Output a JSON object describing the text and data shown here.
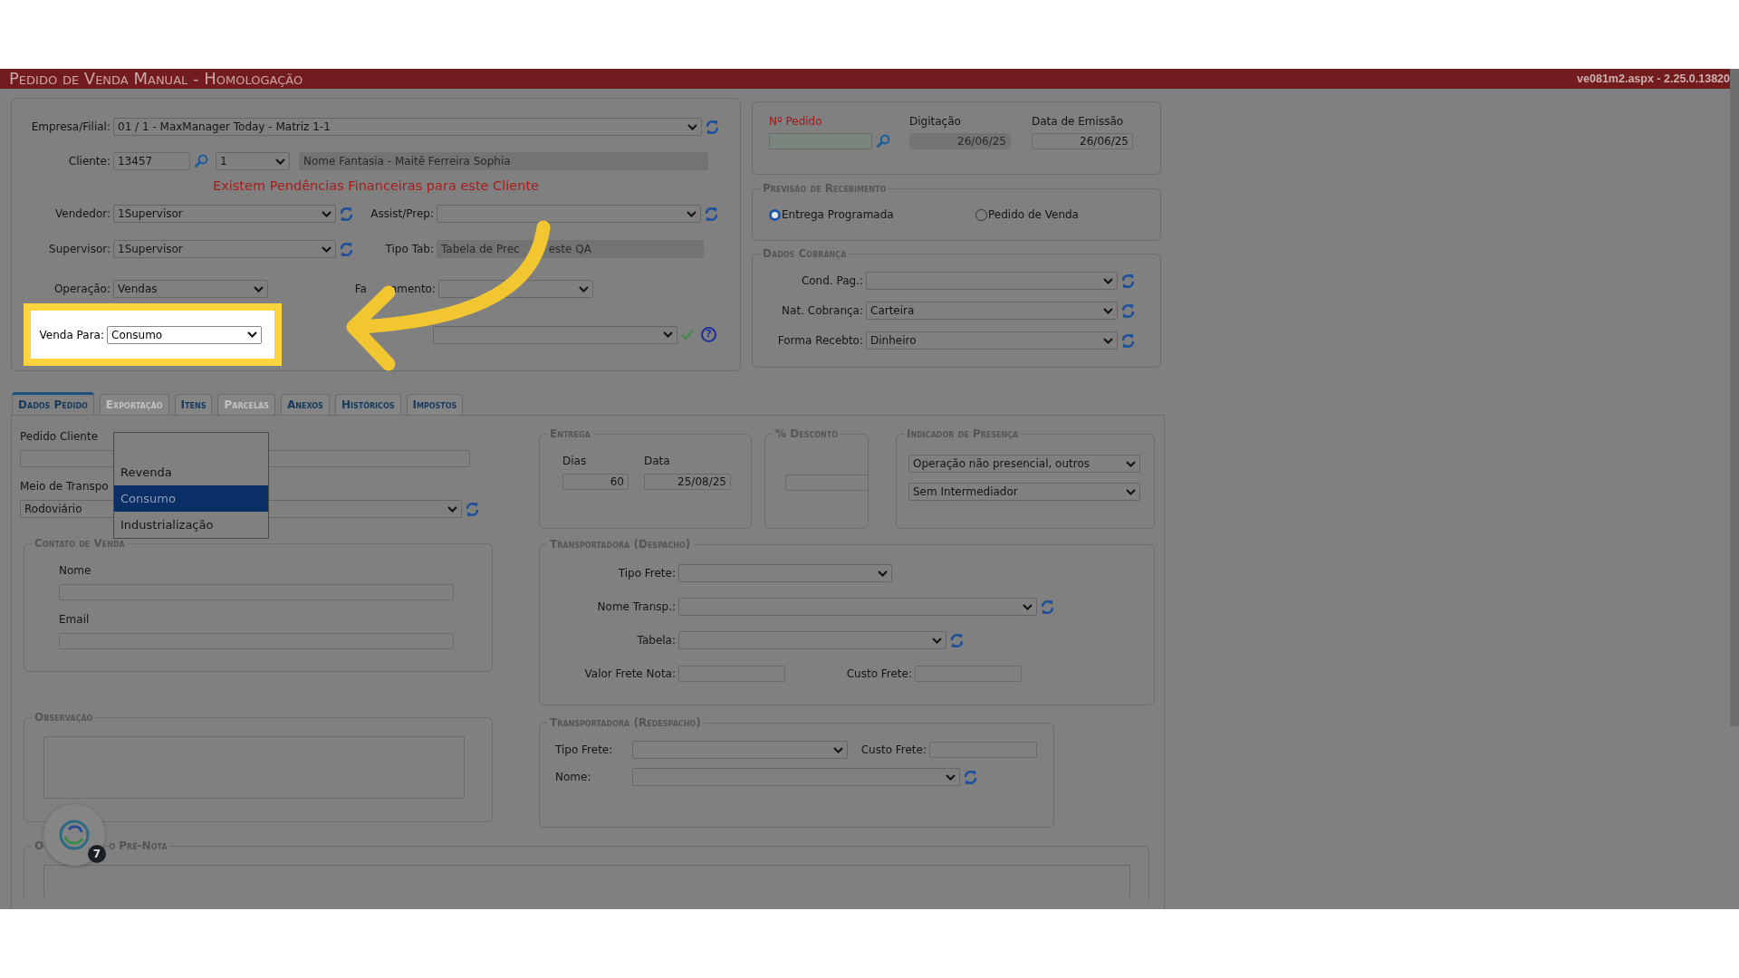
{
  "header": {
    "title": "Pedido de Venda Manual  - Homologação",
    "version": "ve081m2.aspx - 2.25.0.13820"
  },
  "form": {
    "empresa": {
      "label": "Empresa/Filial:",
      "value": "01 / 1 - MaxManager Today - Matriz 1-1"
    },
    "cliente": {
      "label": "Cliente:",
      "code": "13457",
      "seq": "1",
      "fantasia": "Nome Fantasia - Maitê Ferreira Sophia"
    },
    "alert": "Existem Pendências Financeiras para este Cliente",
    "vendedor": {
      "label": "Vendedor:",
      "value": "1Supervisor"
    },
    "assist": {
      "label": "Assist/Prep:"
    },
    "supervisor": {
      "label": "Supervisor:",
      "value": "1Supervisor"
    },
    "tipo_tab": {
      "label": "Tipo Tab:",
      "value_start": "Tabela de Prec",
      "value_end": "este QA"
    },
    "operacao": {
      "label": "Operação:",
      "value": "Vendas"
    },
    "faturamento": {
      "label_start": "Fa",
      "label_end": "amento:"
    },
    "venda_para": {
      "label": "Venda Para:",
      "value": "Consumo",
      "highlighted": true
    },
    "help": "?"
  },
  "pedido": {
    "numero_label": "Nº Pedido",
    "digitacao_label": "Digitação",
    "digitacao": "26/06/25",
    "emissao_label": "Data de Emissão",
    "emissao": "26/06/25"
  },
  "previsao": {
    "legend": "Previsão de Recebimento",
    "options": [
      {
        "label": "Entrega Programada",
        "selected": true
      },
      {
        "label": "Pedido de Venda",
        "selected": false
      }
    ]
  },
  "cobranca": {
    "legend": "Dados Cobrança",
    "fields": [
      {
        "label": "Cond. Pag.:"
      },
      {
        "label": "Nat. Cobrança:",
        "value": "Carteira"
      },
      {
        "label": "Forma Recebto:",
        "value": "Dinheiro"
      }
    ]
  },
  "tabs": [
    {
      "label": "Dados Pedido",
      "selected": true,
      "disabled": false
    },
    {
      "label": "Exportação",
      "selected": false,
      "disabled": true
    },
    {
      "label": "Itens",
      "selected": false,
      "disabled": false
    },
    {
      "label": "Parcelas",
      "selected": false,
      "disabled": true
    },
    {
      "label": "Anexos",
      "selected": false,
      "disabled": false
    },
    {
      "label": "Históricos",
      "selected": false,
      "disabled": false
    },
    {
      "label": "Impostos",
      "selected": false,
      "disabled": false
    }
  ],
  "dados": {
    "pedido_cliente_label": "Pedido Cliente",
    "meio_label": "Meio de Transpo",
    "meio_value": "Rodoviário"
  },
  "contato": {
    "legend": "Contato de Venda",
    "fields": [
      {
        "label": "Nome"
      },
      {
        "label": "Email"
      }
    ]
  },
  "observacao": {
    "legend": "Observação"
  },
  "prenota": {
    "legend_start": "O",
    "legend_end": "o Pré-Nota"
  },
  "entrega": {
    "legend": "Entrega",
    "dias_label": "Dias",
    "dias": "60",
    "data_label": "Data",
    "data": "25/08/25"
  },
  "desconto": {
    "legend": "% Desconto"
  },
  "indicador": {
    "legend": "Indicador de Presença",
    "selects": [
      "Operação não presencial, outros",
      "Sem Intermediador"
    ]
  },
  "despacho": {
    "legend": "Transportadora (Despacho)",
    "tipo_frete": "Tipo Frete:",
    "nome_transp": "Nome Transp.:",
    "tabela": "Tabela:",
    "valor_frete": "Valor Frete Nota:",
    "custo_frete": "Custo Frete:"
  },
  "redespacho": {
    "legend": "Transportadora (Redespacho)",
    "tipo_frete": "Tipo Frete:",
    "custo_frete": "Custo Frete:",
    "nome": "Nome:"
  },
  "dropdown": {
    "options": [
      {
        "label": "Revenda",
        "selected": false
      },
      {
        "label": "Consumo",
        "selected": true
      },
      {
        "label": "Industrialização",
        "selected": false
      }
    ]
  },
  "chat": {
    "badge": "7"
  }
}
